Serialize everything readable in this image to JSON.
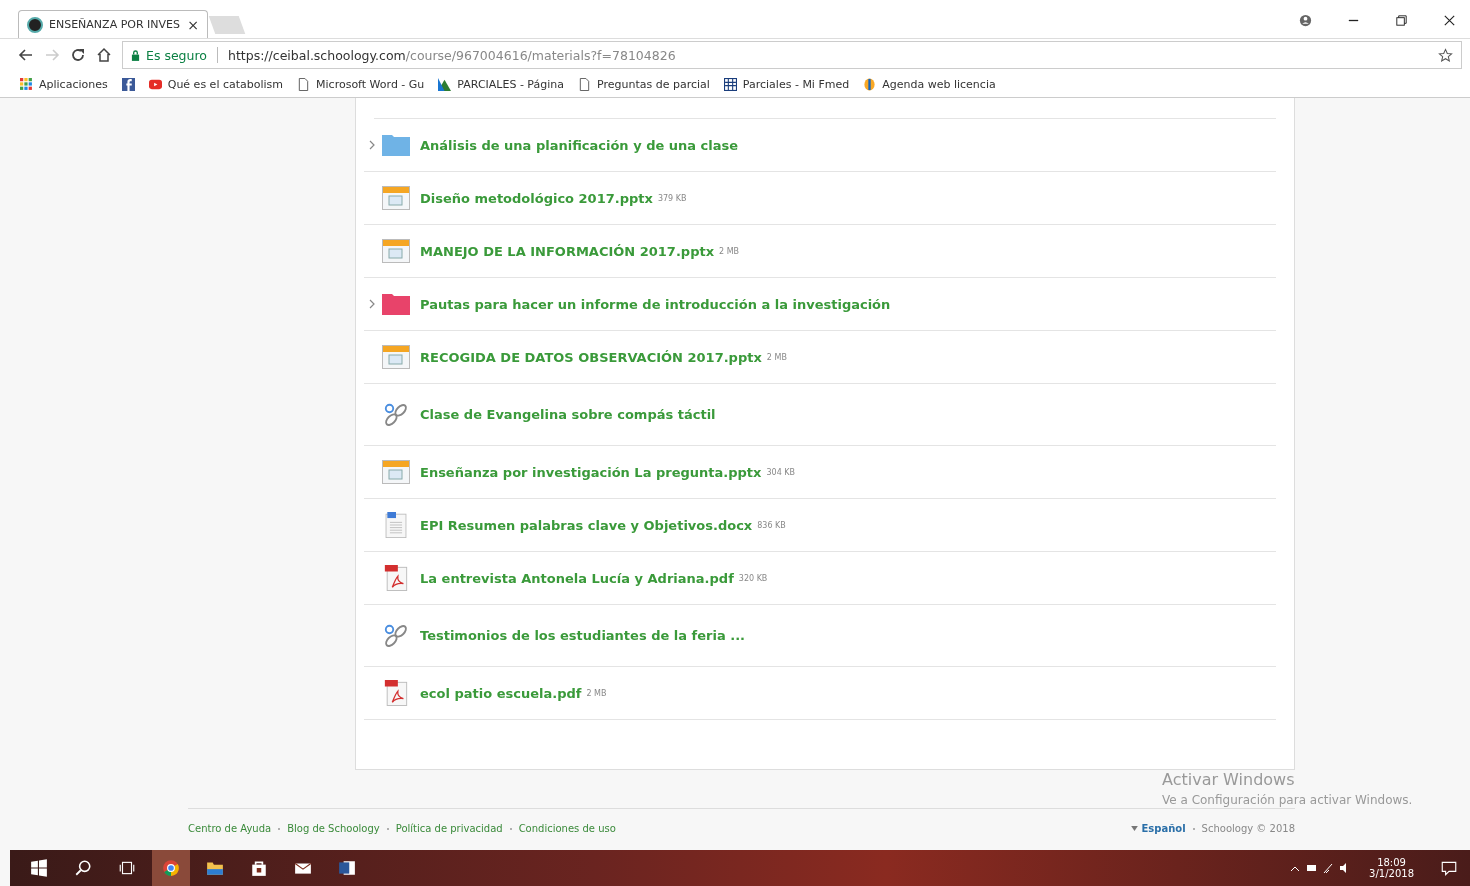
{
  "browser": {
    "tab": {
      "title": "ENSEÑANZA POR INVES",
      "close": "×"
    },
    "security": "Es seguro",
    "url": {
      "host": "https://ceibal.schoology.com",
      "path": "/course/967004616/materials?f=78104826"
    },
    "bookmarks": [
      {
        "kind": "apps",
        "label": "Aplicaciones"
      },
      {
        "kind": "facebook"
      },
      {
        "kind": "youtube",
        "label": "Qué es el catabolism"
      },
      {
        "kind": "page",
        "label": "Microsoft Word - Gu"
      },
      {
        "kind": "chart",
        "label": "PARCIALES - Página"
      },
      {
        "kind": "page",
        "label": "Preguntas de parcial"
      },
      {
        "kind": "grid",
        "label": "Parciales - Mi Fmed"
      },
      {
        "kind": "globe",
        "label": "Agenda web licencia"
      }
    ]
  },
  "materials": [
    {
      "kind": "folder",
      "color": "#6fb3e6",
      "expandable": true,
      "title": "Análisis de una planificación y de una clase"
    },
    {
      "kind": "pptx",
      "title": "Diseño metodológico 2017.pptx",
      "size": "379 KB"
    },
    {
      "kind": "pptx",
      "title": "MANEJO DE LA INFORMACIÓN 2017.pptx",
      "size": "2 MB"
    },
    {
      "kind": "folder",
      "color": "#e8436a",
      "expandable": true,
      "title": "Pautas para hacer un informe de introducción a la investigación"
    },
    {
      "kind": "pptx",
      "title": "RECOGIDA DE DATOS OBSERVACIÓN 2017.pptx",
      "size": "2 MB"
    },
    {
      "kind": "link",
      "title": "Clase de Evangelina sobre compás táctil"
    },
    {
      "kind": "pptx",
      "title": "Enseñanza por investigación La pregunta.pptx",
      "size": "304 KB"
    },
    {
      "kind": "docx",
      "title": "EPI Resumen palabras clave y Objetivos.docx",
      "size": "836 KB"
    },
    {
      "kind": "pdf",
      "title": "La entrevista Antonela Lucía y Adriana.pdf",
      "size": "320 KB"
    },
    {
      "kind": "link",
      "title": "Testimonios de los estudiantes de la feria ..."
    },
    {
      "kind": "pdf",
      "title": "ecol patio escuela.pdf",
      "size": "2 MB"
    }
  ],
  "activation": {
    "title": "Activar Windows",
    "hint": "Ve a Configuración para activar Windows."
  },
  "footer": {
    "links": [
      "Centro de Ayuda",
      "Blog de Schoology",
      "Política de privacidad",
      "Condiciones de uso"
    ],
    "language": "Español",
    "copyright": "Schoology © 2018"
  },
  "taskbar": {
    "apps": [
      {
        "kind": "start"
      },
      {
        "kind": "search"
      },
      {
        "kind": "taskview"
      },
      {
        "kind": "chrome"
      },
      {
        "kind": "explorer"
      },
      {
        "kind": "store"
      },
      {
        "kind": "mail"
      },
      {
        "kind": "word"
      }
    ],
    "time": "18:09",
    "date": "3/1/2018"
  }
}
